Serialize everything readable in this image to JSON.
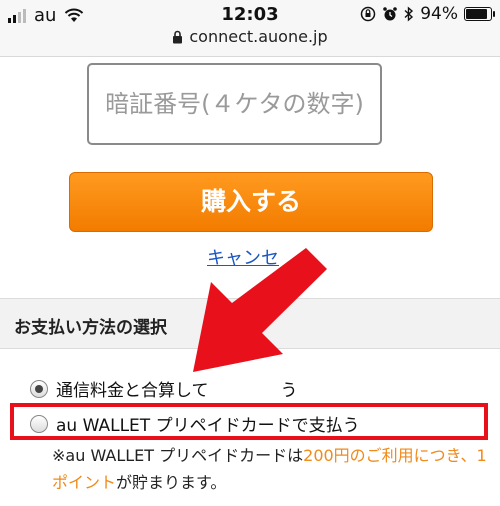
{
  "status_bar": {
    "carrier": "au",
    "time": "12:03",
    "battery": "94%",
    "battery_level": 0.94
  },
  "url_bar": {
    "url": "connect.auone.jp"
  },
  "pin": {
    "placeholder": "暗証番号(４ケタの数字)"
  },
  "purchase": {
    "button_label": "購入する",
    "cancel_label": "キャンセ"
  },
  "payment": {
    "section_title": "お支払い方法の選択",
    "option1_label": "通信料金と合算して",
    "option1_tail": "う",
    "option2_label": "au WALLET プリペイドカードで支払う",
    "note_prefix": "※au WALLET プリペイドカードは",
    "note_highlight1": "200円のご利用につき、1ポイント",
    "note_suffix": "が貯まります。"
  },
  "colors": {
    "accent_orange": "#f27c00",
    "annotation_red": "#e8101a",
    "link_blue": "#1a56c4"
  },
  "icons": [
    "signal-icon",
    "wifi-icon",
    "lock-icon",
    "orientation-lock-icon",
    "alarm-icon",
    "bluetooth-icon",
    "battery-icon",
    "red-arrow-annotation"
  ]
}
